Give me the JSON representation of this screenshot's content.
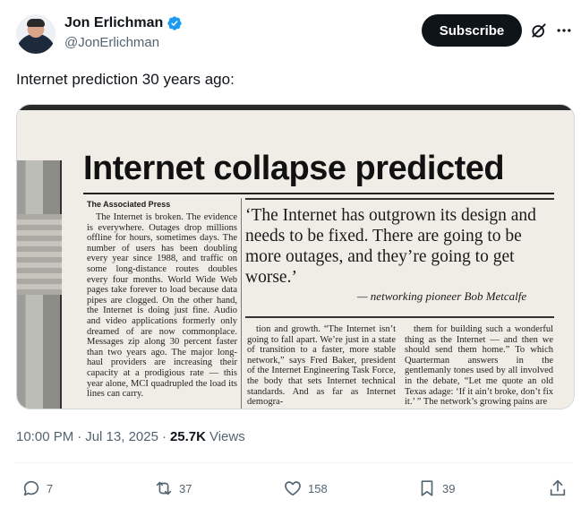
{
  "author": {
    "display_name": "Jon Erlichman",
    "handle": "@JonErlichman",
    "verified": true
  },
  "header": {
    "subscribe_label": "Subscribe",
    "icons": [
      "verified-badge-icon",
      "grok-icon",
      "more-options-icon"
    ]
  },
  "tweet": {
    "text": "Internet prediction 30 years ago:"
  },
  "clipping": {
    "headline": "Internet collapse predicted",
    "byline": "The Associated Press",
    "col1": "The Internet is broken. The evidence is everywhere. Outages drop millions offline for hours, sometimes days. The number of users has been doubling every year since 1988, and traffic on some long-distance routes doubles every four months. World Wide Web pages take forever to load because data pipes are clogged. On the other hand, the Internet is doing just fine. Audio and video applications formerly only dreamed of are now commonplace. Messages zip along 30 percent faster than two years ago. The major long-haul providers are increasing their capacity at a prodigious rate — this year alone, MCI quadrupled the load its lines can carry.",
    "pullquote": "‘The Internet has outgrown its design and needs to be fixed. There are going to be more outages, and they’re going to get worse.’",
    "attribution": "— networking pioneer Bob Metcalfe",
    "col2": "tion and growth. “The Internet isn’t going to fall apart. We’re just in a state of transition to a faster, more stable network,” says Fred Baker, president of the Internet Engineering Task Force, the body that sets Internet technical standards. And as far as Internet demogra-",
    "col3": "them for building such a wonderful thing as the Internet — and then we should send them home.” To which Quarterman answers in the gentlemanly tones used by all involved in the debate, “Let me quote an old Texas adage: ‘If it ain’t broke, don’t fix it.’ ” The network’s growing pains are"
  },
  "meta": {
    "time": "10:00 PM",
    "separator": "·",
    "date": "Jul 13, 2025",
    "views_count": "25.7K",
    "views_label": "Views"
  },
  "actions": {
    "reply_count": "7",
    "repost_count": "37",
    "like_count": "158",
    "bookmark_count": "39"
  },
  "colors": {
    "text_primary": "#0f1419",
    "text_secondary": "#536471",
    "verified_blue": "#1d9bf0",
    "button_dark": "#0f1419"
  }
}
